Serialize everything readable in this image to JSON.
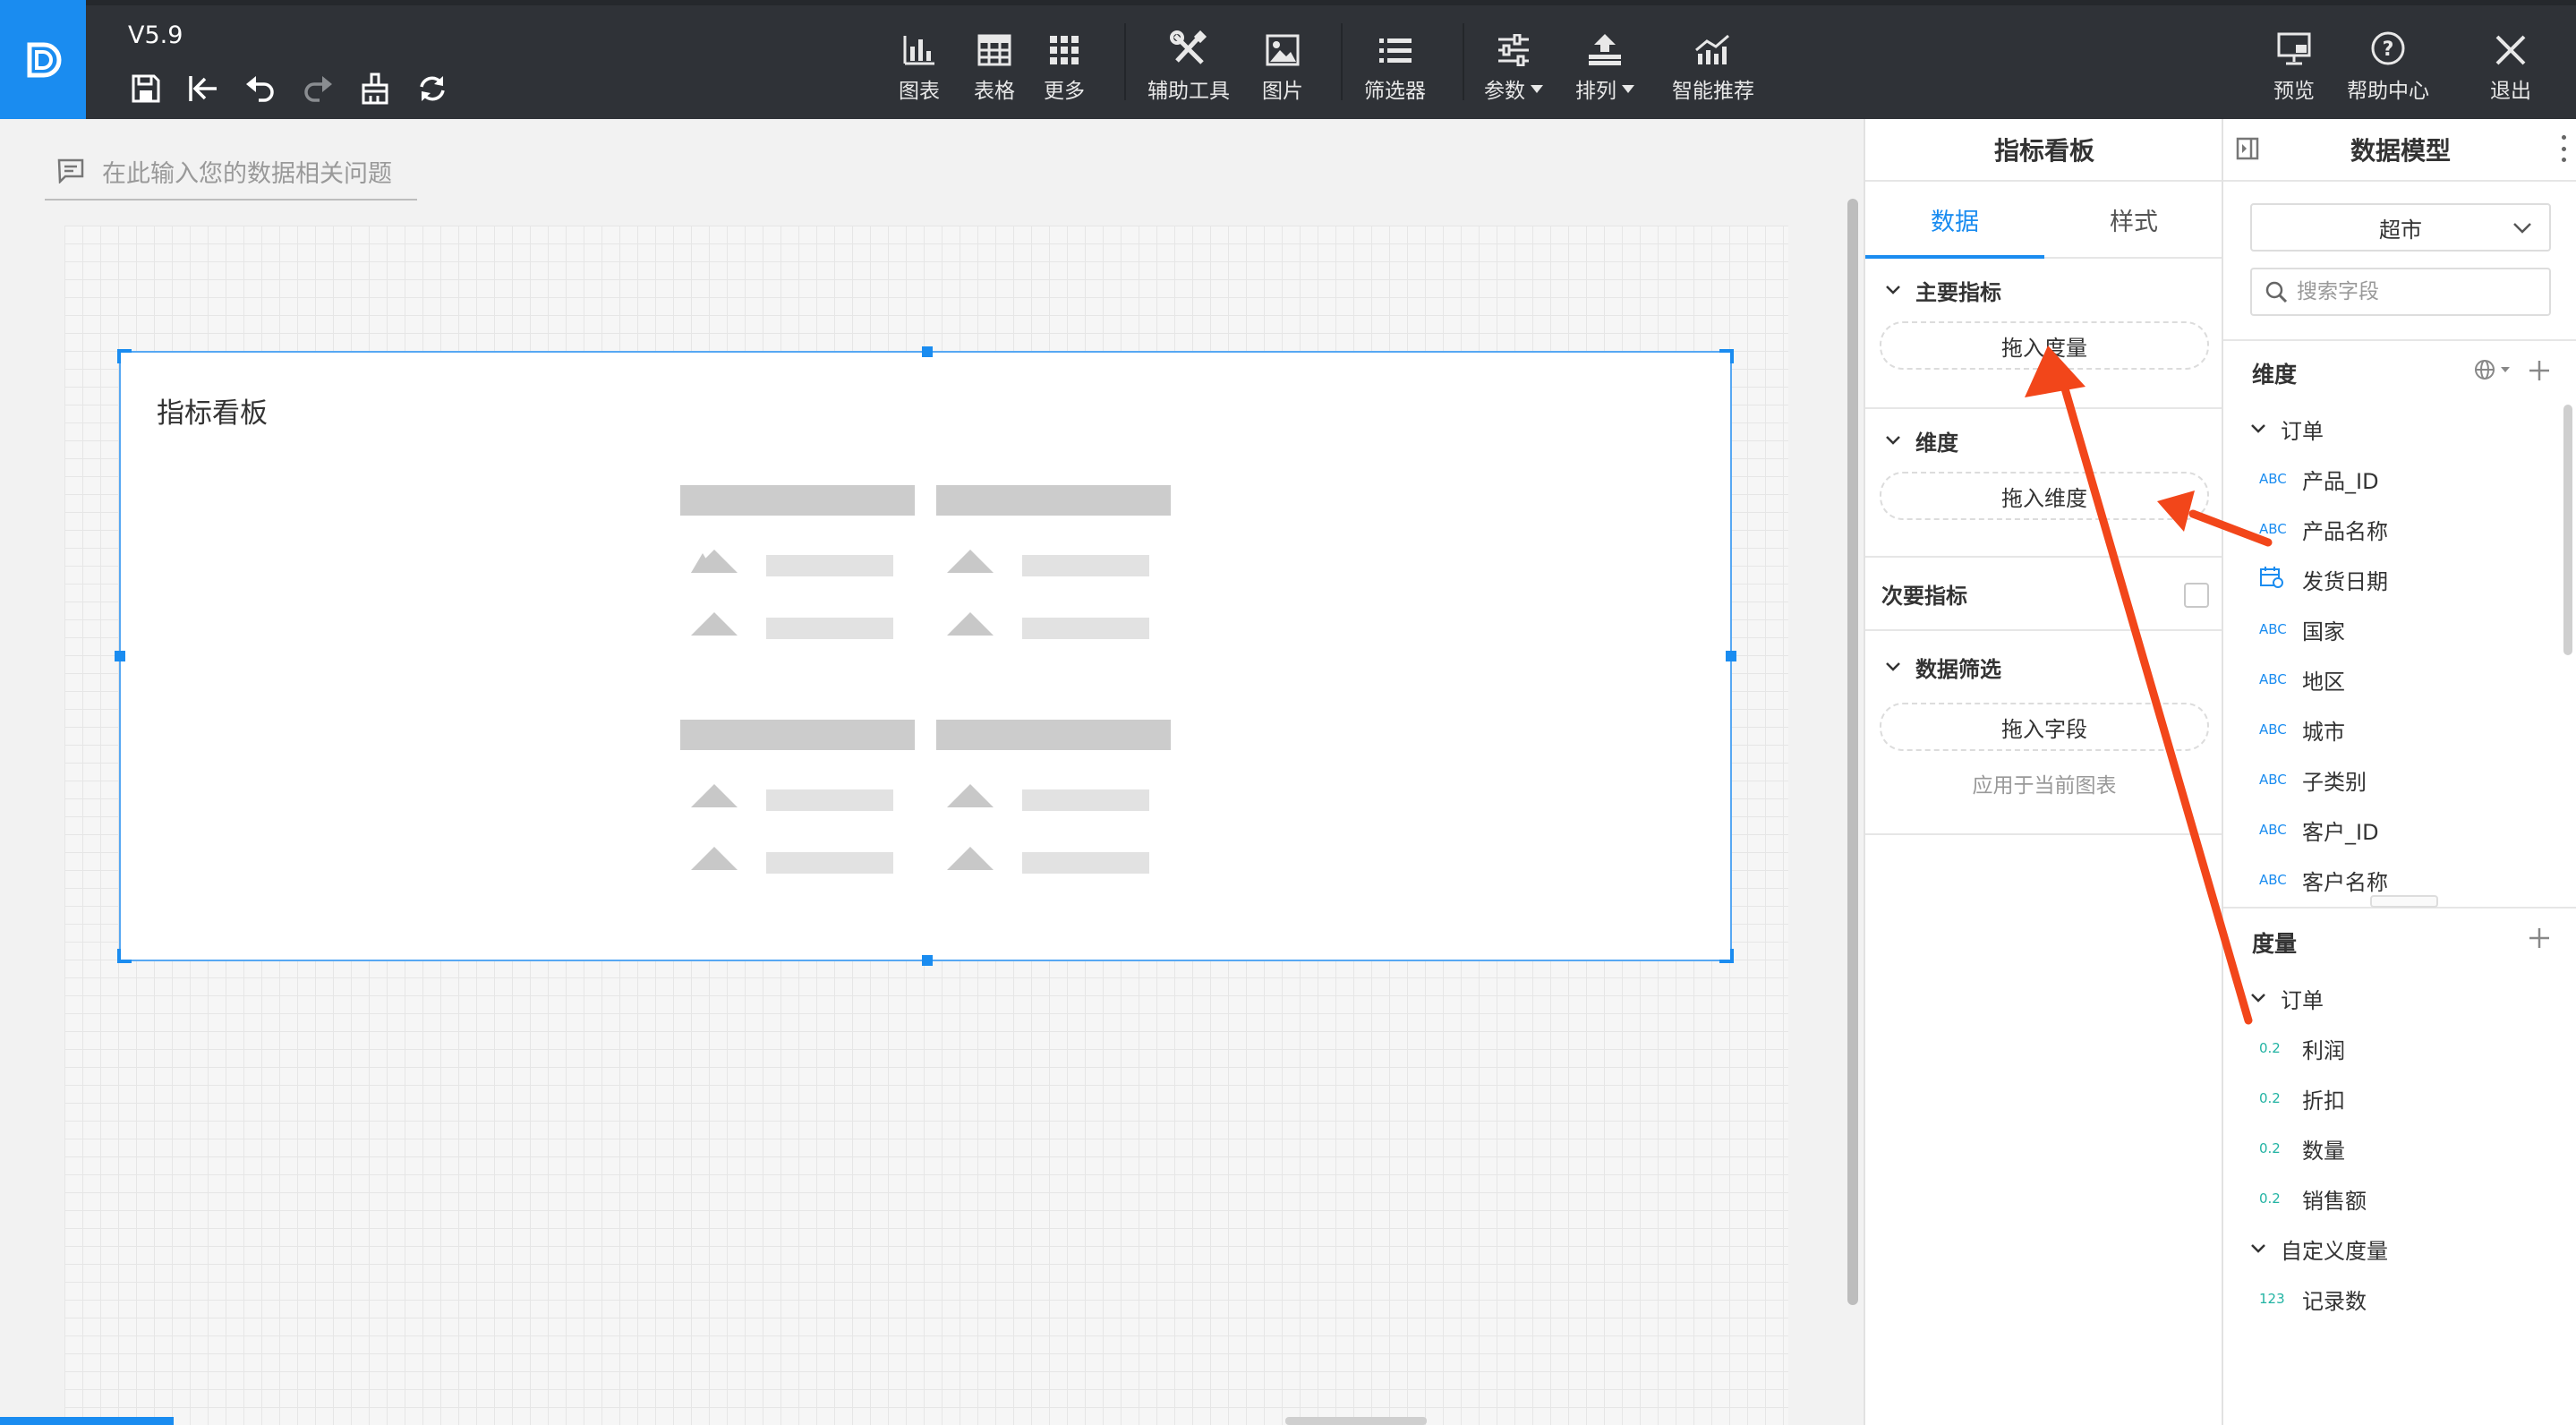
{
  "toolbar": {
    "version": "V5.9",
    "quick_tools": [
      {
        "name": "save-icon"
      },
      {
        "name": "back-to-start-icon"
      },
      {
        "name": "undo-icon"
      },
      {
        "name": "redo-icon"
      },
      {
        "name": "format-brush-icon"
      },
      {
        "name": "refresh-icon"
      }
    ],
    "buttons": {
      "chart": "图表",
      "table": "表格",
      "more": "更多",
      "aux_tools": "辅助工具",
      "image": "图片",
      "filter": "筛选器",
      "params": "参数",
      "arrange": "排列",
      "smart_recommend": "智能推荐",
      "preview": "预览",
      "help": "帮助中心",
      "exit": "退出"
    }
  },
  "canvas": {
    "ask_placeholder": "在此输入您的数据相关问题",
    "widget_title": "指标看板"
  },
  "mid_panel": {
    "title": "指标看板",
    "tabs": [
      "数据",
      "样式"
    ],
    "active_tab": 0,
    "sections": {
      "main_metric": {
        "title": "主要指标",
        "drop": "拖入度量"
      },
      "dimension": {
        "title": "维度",
        "drop": "拖入维度"
      },
      "secondary": {
        "title": "次要指标",
        "checked": false
      },
      "filter": {
        "title": "数据筛选",
        "drop": "拖入字段",
        "hint": "应用于当前图表"
      }
    }
  },
  "right_panel": {
    "title": "数据模型",
    "dataset": "超市",
    "search_placeholder": "搜索字段",
    "dimensions": {
      "title": "维度",
      "groups": [
        {
          "name": "订单",
          "fields": [
            {
              "type": "ABC",
              "label": "产品_ID"
            },
            {
              "type": "ABC",
              "label": "产品名称"
            },
            {
              "type": "date",
              "label": "发货日期"
            },
            {
              "type": "ABC",
              "label": "国家"
            },
            {
              "type": "ABC",
              "label": "地区"
            },
            {
              "type": "ABC",
              "label": "城市"
            },
            {
              "type": "ABC",
              "label": "子类别"
            },
            {
              "type": "ABC",
              "label": "客户_ID"
            },
            {
              "type": "ABC",
              "label": "客户名称"
            }
          ]
        }
      ]
    },
    "measures": {
      "title": "度量",
      "groups": [
        {
          "name": "订单",
          "fields": [
            {
              "type": "0.2",
              "label": "利润"
            },
            {
              "type": "0.2",
              "label": "折扣"
            },
            {
              "type": "0.2",
              "label": "数量"
            },
            {
              "type": "0.2",
              "label": "销售额"
            }
          ]
        },
        {
          "name": "自定义度量",
          "fields": [
            {
              "type": "123",
              "label": "记录数"
            }
          ]
        }
      ]
    }
  },
  "colors": {
    "accent": "#1a8cf0",
    "toolbar_bg": "#2f3237",
    "annotation_arrow": "#f2461a"
  }
}
